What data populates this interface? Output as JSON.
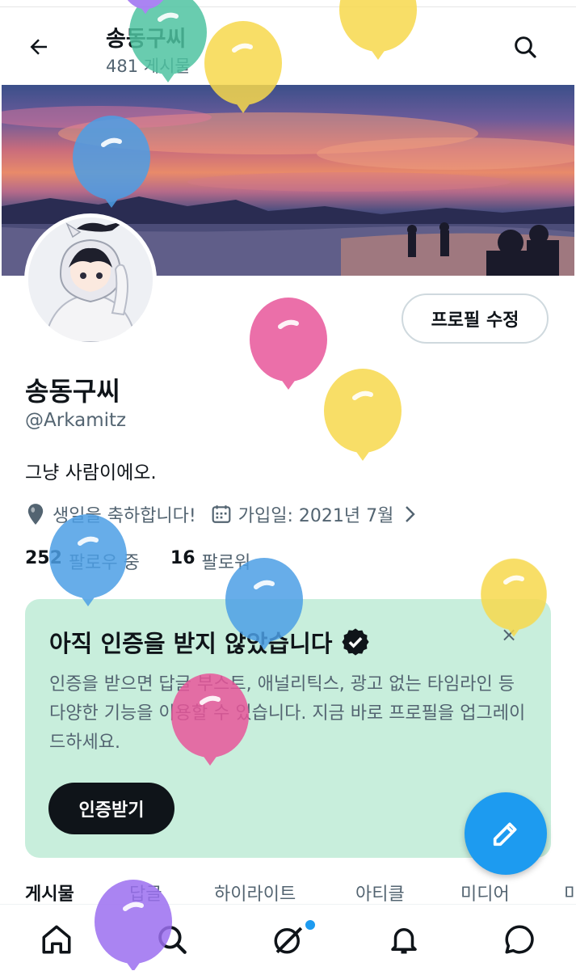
{
  "header": {
    "title": "송동구씨",
    "post_count": "481 게시물"
  },
  "profile": {
    "edit_button": "프로필 수정",
    "display_name": "송동구씨",
    "handle": "@Arkamitz",
    "bio": "그냥 사람이에오.",
    "birthday": "생일을 축하합니다!",
    "joined": "가입일: 2021년 7월",
    "following_count": "252",
    "following_label": "팔로우 중",
    "followers_count": "16",
    "followers_label": "팔로워"
  },
  "verify_card": {
    "title": "아직 인증을 받지 않았습니다",
    "body": "인증을 받으면 답글 부스트, 애널리틱스, 광고 없는 타임라인 등 다양한 기능을 이용할 수 있습니다. 지금 바로 프로필을 업그레이드하세요.",
    "button": "인증받기",
    "close": "×"
  },
  "tabs": [
    "게시물",
    "답글",
    "하이라이트",
    "아티클",
    "미디어",
    "미"
  ],
  "active_tab": 0,
  "icons": {
    "back": "arrow-left-icon",
    "search": "search-icon",
    "location": "location-pin-icon",
    "calendar": "calendar-icon",
    "chevron": "chevron-right-icon",
    "verified": "verified-badge-icon",
    "compose": "compose-icon",
    "home": "home-icon",
    "explore": "search-icon",
    "grok": "grok-icon",
    "notifications": "bell-icon",
    "messages": "message-icon"
  },
  "colors": {
    "accent": "#1d9bf0",
    "card_bg": "#c8eedc",
    "text_secondary": "#536471",
    "balloon_yellow": "#f7d94c",
    "balloon_pink": "#e8559a",
    "balloon_blue": "#4c9fe6",
    "balloon_green": "#4fc3a1",
    "balloon_purple": "#9b6ef0"
  }
}
